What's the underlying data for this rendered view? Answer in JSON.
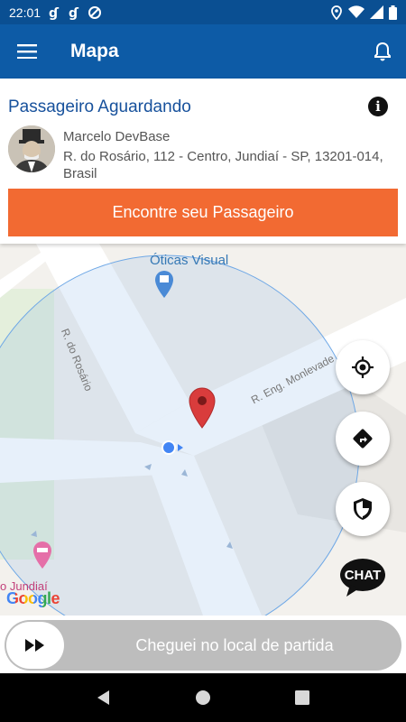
{
  "status_bar": {
    "time": "22:01",
    "icons": [
      "app-notification-icon",
      "app-notification-icon",
      "do-not-disturb-icon",
      "location-icon",
      "wifi-icon",
      "signal-icon",
      "battery-icon"
    ]
  },
  "app_bar": {
    "title": "Mapa",
    "menu_icon": "hamburger-menu-icon",
    "bell_icon": "bell-icon",
    "background": "#0d5ba6"
  },
  "passenger_card": {
    "title": "Passageiro Aguardando",
    "info_icon": "info-icon",
    "name": "Marcelo DevBase",
    "address": "R. do Rosário, 112 - Centro, Jundiaí - SP, 13201-014, Brasil",
    "find_button_label": "Encontre seu Passageiro",
    "find_button_color": "#f26a32"
  },
  "map": {
    "poi_label": "Óticas Visual",
    "street_1": "R. do Rosário",
    "street_2": "R. Eng. Monlevade",
    "city_label": "o Jundiaí",
    "attribution": "Google",
    "fab_buttons": [
      "my-location-icon",
      "directions-icon",
      "shield-icon"
    ],
    "chat_label": "CHAT"
  },
  "slider": {
    "label": "Cheguei no local de partida",
    "thumb_icon": "fast-forward-icon"
  },
  "nav_bar": {
    "buttons": [
      "back-icon",
      "home-icon",
      "recents-icon"
    ]
  }
}
